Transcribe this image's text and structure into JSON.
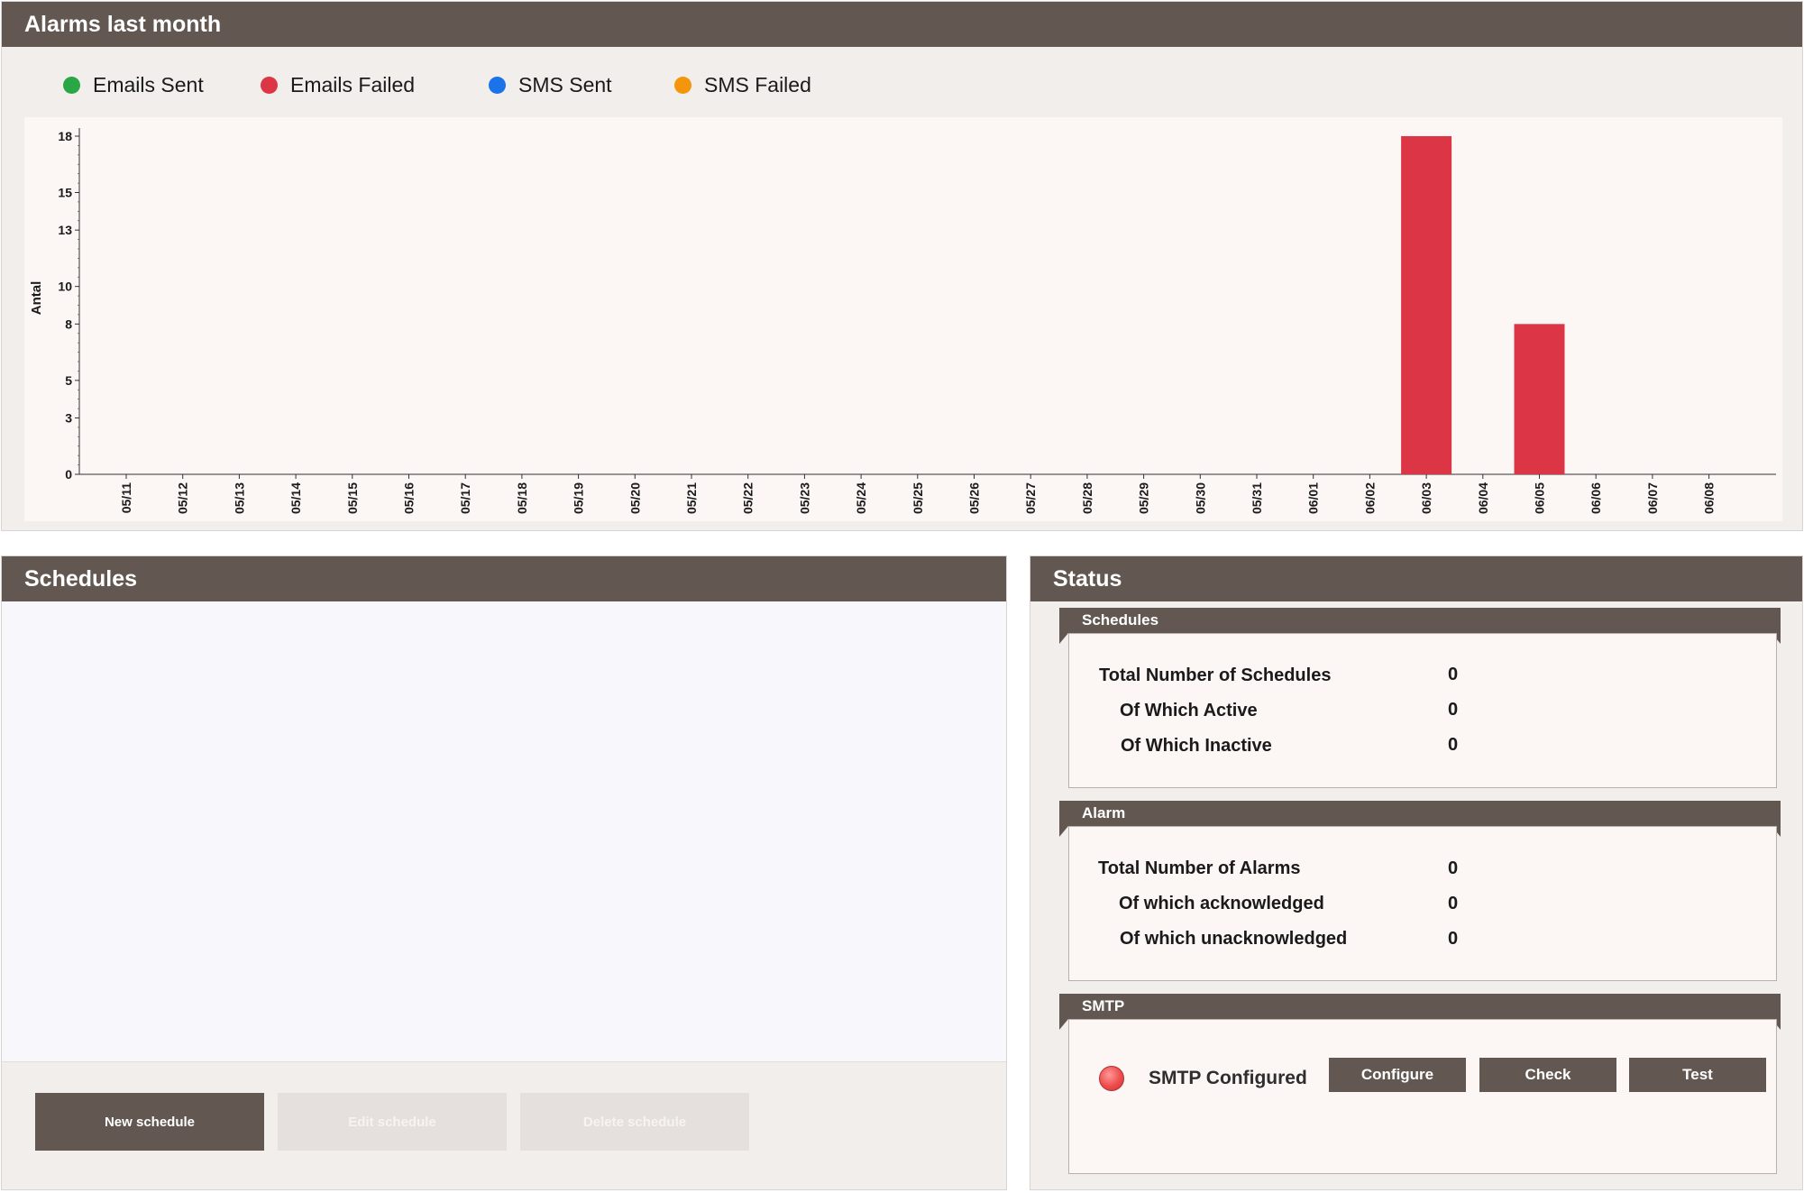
{
  "alarms": {
    "title": "Alarms last month",
    "legend": [
      {
        "label": "Emails Sent",
        "color": "#2aa745"
      },
      {
        "label": "Emails Failed",
        "color": "#dc3545"
      },
      {
        "label": "SMS Sent",
        "color": "#1a73e8"
      },
      {
        "label": "SMS Failed",
        "color": "#f5950b"
      }
    ]
  },
  "chart_data": {
    "type": "bar",
    "ylabel": "Antal",
    "xlabel": "",
    "ylim": [
      0,
      18
    ],
    "yticks": [
      "0",
      "3",
      "5",
      "8",
      "10",
      "13",
      "15",
      "18"
    ],
    "categories": [
      "05/11",
      "05/12",
      "05/13",
      "05/14",
      "05/15",
      "05/16",
      "05/17",
      "05/18",
      "05/19",
      "05/20",
      "05/21",
      "05/22",
      "05/23",
      "05/24",
      "05/25",
      "05/26",
      "05/27",
      "05/28",
      "05/29",
      "05/30",
      "05/31",
      "06/01",
      "06/02",
      "06/03",
      "06/04",
      "06/05",
      "06/06",
      "06/07",
      "06/08"
    ],
    "series": [
      {
        "name": "Emails Sent",
        "color": "#2aa745",
        "values": [
          0,
          0,
          0,
          0,
          0,
          0,
          0,
          0,
          0,
          0,
          0,
          0,
          0,
          0,
          0,
          0,
          0,
          0,
          0,
          0,
          0,
          0,
          0,
          0,
          0,
          0,
          0,
          0,
          0
        ]
      },
      {
        "name": "Emails Failed",
        "color": "#dc3545",
        "values": [
          0,
          0,
          0,
          0,
          0,
          0,
          0,
          0,
          0,
          0,
          0,
          0,
          0,
          0,
          0,
          0,
          0,
          0,
          0,
          0,
          0,
          0,
          0,
          18,
          0,
          8,
          0,
          0,
          0
        ]
      },
      {
        "name": "SMS Sent",
        "color": "#1a73e8",
        "values": [
          0,
          0,
          0,
          0,
          0,
          0,
          0,
          0,
          0,
          0,
          0,
          0,
          0,
          0,
          0,
          0,
          0,
          0,
          0,
          0,
          0,
          0,
          0,
          0,
          0,
          0,
          0,
          0,
          0
        ]
      },
      {
        "name": "SMS Failed",
        "color": "#f5950b",
        "values": [
          0,
          0,
          0,
          0,
          0,
          0,
          0,
          0,
          0,
          0,
          0,
          0,
          0,
          0,
          0,
          0,
          0,
          0,
          0,
          0,
          0,
          0,
          0,
          0,
          0,
          0,
          0,
          0,
          0
        ]
      }
    ],
    "grid": false,
    "legend_position": "top-left"
  },
  "schedules": {
    "title": "Schedules",
    "buttons": {
      "new": "New schedule",
      "edit": "Edit schedule",
      "delete": "Delete schedule"
    }
  },
  "status": {
    "title": "Status",
    "schedules": {
      "title": "Schedules",
      "total_label": "Total Number of Schedules",
      "total": "0",
      "active_label": "Of Which Active",
      "active": "0",
      "inactive_label": "Of Which Inactive",
      "inactive": "0"
    },
    "alarm": {
      "title": "Alarm",
      "total_label": "Total Number of Alarms",
      "total": "0",
      "ack_label": "Of which acknowledged",
      "ack": "0",
      "unack_label": "Of which unacknowledged",
      "unack": "0"
    },
    "smtp": {
      "title": "SMTP",
      "configured_label": "SMTP Configured",
      "configured": false,
      "indicator_color": "#ee4c4c",
      "configure_button": "Configure",
      "check_button": "Check",
      "test_button": "Test"
    }
  }
}
